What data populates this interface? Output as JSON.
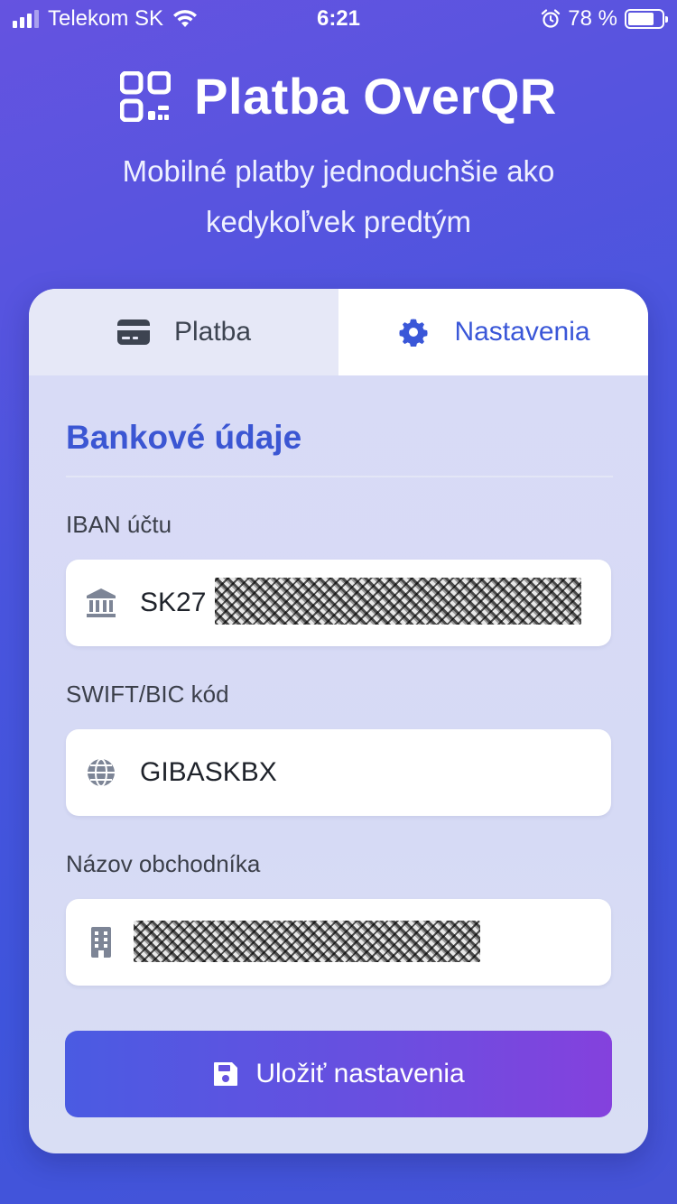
{
  "status_bar": {
    "carrier": "Telekom SK",
    "time": "6:21",
    "battery_percent": "78 %",
    "battery_level": 0.78,
    "signal_bars": 3,
    "icons": [
      "signal-icon",
      "wifi-icon",
      "alarm-icon",
      "battery-icon"
    ]
  },
  "header": {
    "title": "Platba OverQR",
    "subtitle": "Mobilné platby jednoduchšie ako kedykoľvek predtým",
    "logo_icon": "qr-code-icon"
  },
  "tabs": [
    {
      "label": "Platba",
      "icon": "credit-card-icon",
      "active": false
    },
    {
      "label": "Nastavenia",
      "icon": "gear-icon",
      "active": true
    }
  ],
  "settings": {
    "section_title": "Bankové údaje",
    "fields": {
      "iban": {
        "label": "IBAN účtu",
        "value": "SK27",
        "icon": "bank-icon",
        "redacted": true
      },
      "swift": {
        "label": "SWIFT/BIC kód",
        "value": "GIBASKBX",
        "icon": "globe-icon"
      },
      "merchant": {
        "label": "Názov obchodníka",
        "value": "",
        "icon": "building-icon",
        "redacted": true
      }
    },
    "save_label": "Uložiť nastavenia",
    "save_icon": "save-icon"
  },
  "colors": {
    "accent": "#3b56d3",
    "background_start": "#6553e0",
    "background_end": "#4653d6",
    "button_start": "#4a5be2",
    "button_end": "#8441dd"
  }
}
